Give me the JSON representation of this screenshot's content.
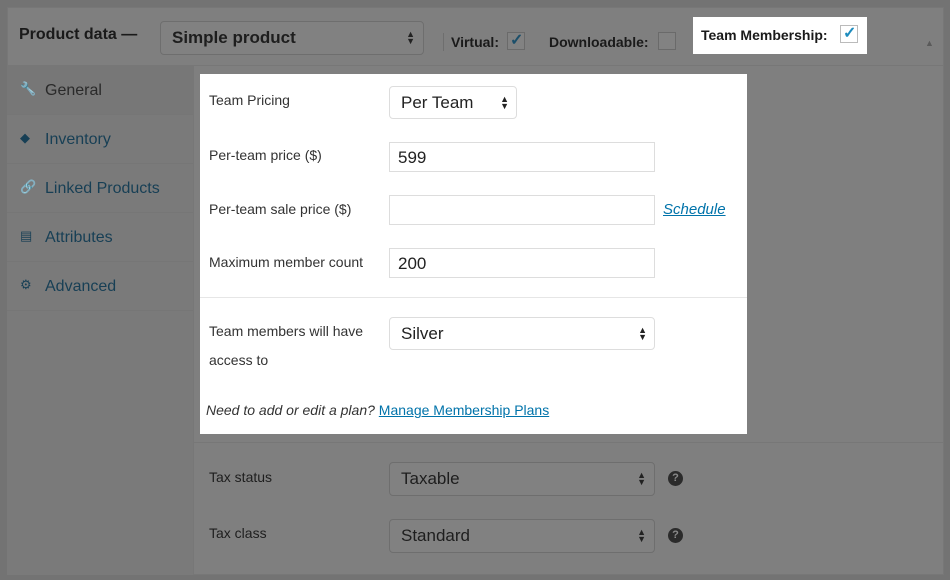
{
  "header": {
    "title": "Product data —",
    "product_type": "Simple product",
    "virtual_label": "Virtual:",
    "virtual_checked": true,
    "downloadable_label": "Downloadable:",
    "downloadable_checked": false,
    "team_membership_label": "Team Membership:",
    "team_membership_checked": true,
    "collapse_icon": "▲",
    "check_glyph": "✓"
  },
  "sidebar": {
    "items": [
      {
        "label": "General",
        "icon": "wrench-icon",
        "glyph": "🔧",
        "active": true
      },
      {
        "label": "Inventory",
        "icon": "tag-icon",
        "glyph": "◆",
        "active": false
      },
      {
        "label": "Linked Products",
        "icon": "link-icon",
        "glyph": "🔗",
        "active": false
      },
      {
        "label": "Attributes",
        "icon": "list-icon",
        "glyph": "▤",
        "active": false
      },
      {
        "label": "Advanced",
        "icon": "gear-icon",
        "glyph": "⚙",
        "active": false
      }
    ]
  },
  "team_card": {
    "team_pricing_label": "Team Pricing",
    "team_pricing_value": "Per Team",
    "per_team_price_label": "Per-team price ($)",
    "per_team_price_value": "599",
    "per_team_sale_label": "Per-team sale price ($)",
    "per_team_sale_value": "",
    "schedule_link": "Schedule",
    "max_member_label": "Maximum member count",
    "max_member_value": "200",
    "access_label_line1": "Team members will have",
    "access_label_line2": "access to",
    "access_value": "Silver",
    "note_text": "Need to add or edit a plan?",
    "manage_link": "Manage Membership Plans"
  },
  "tax": {
    "status_label": "Tax status",
    "status_value": "Taxable",
    "class_label": "Tax class",
    "class_value": "Standard",
    "help_glyph": "?"
  },
  "select_arrows": "▲\n▼",
  "colors": {
    "link": "#0073aa",
    "checkmark": "#1e8cbe",
    "overlay_gray": "#7f7f7f"
  }
}
